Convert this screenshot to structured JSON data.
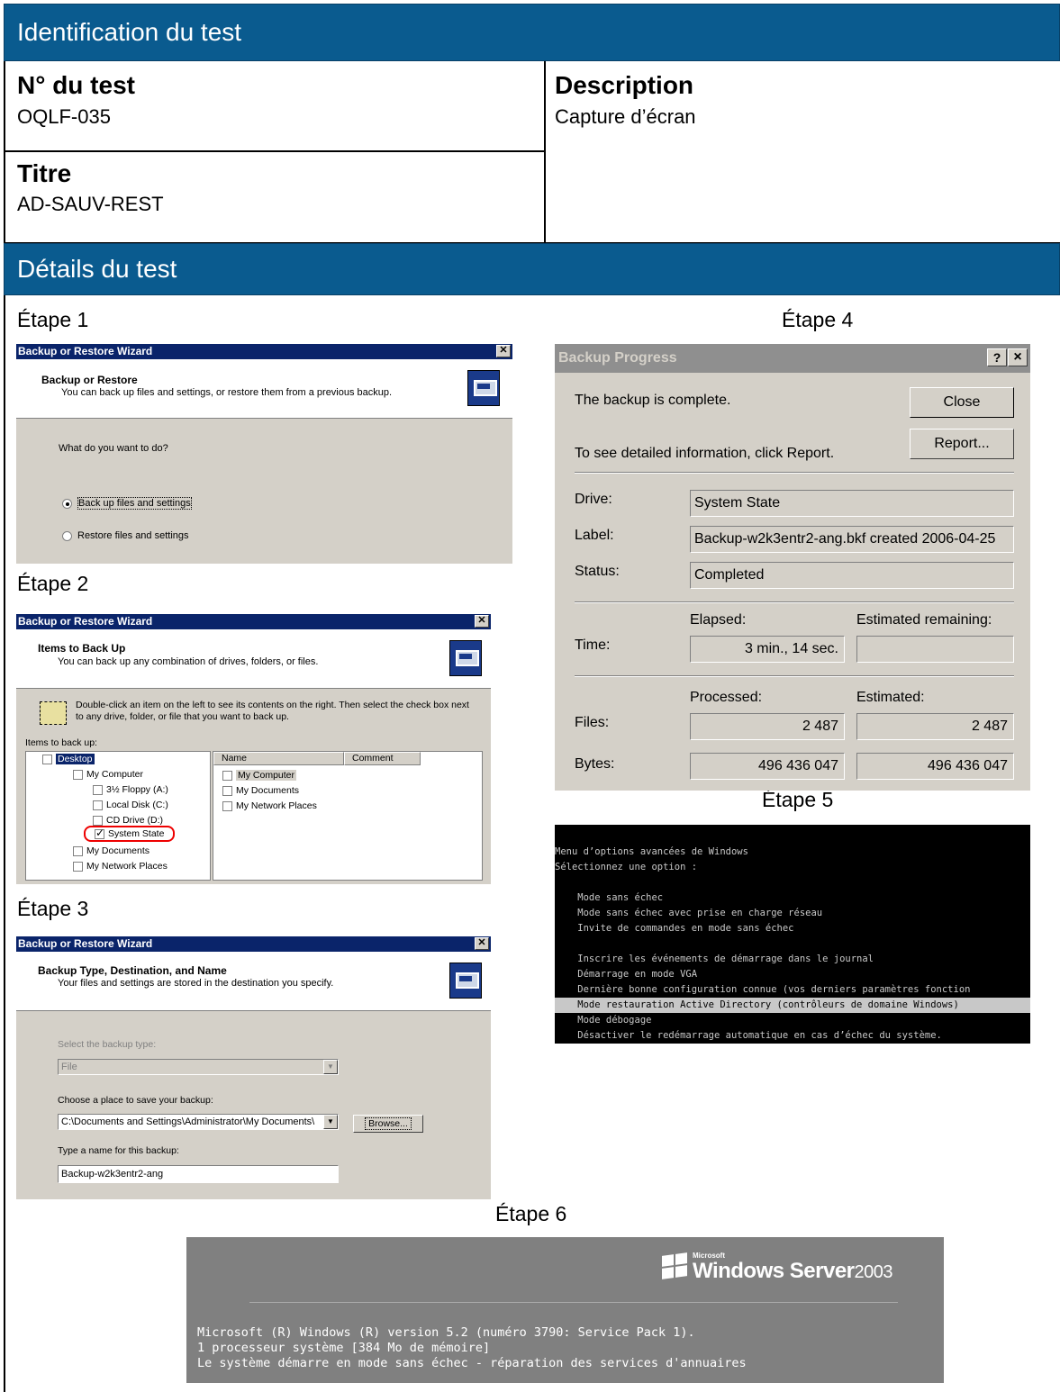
{
  "header": {
    "identification_title": "Identification du test",
    "details_title": "Détails du test"
  },
  "test": {
    "number_label": "N° du test",
    "number_value": "OQLF-035",
    "description_label": "Description",
    "description_value": "Capture d’écran",
    "title_label": "Titre",
    "title_value": "AD-SAUV-REST"
  },
  "steps": {
    "s1": "Étape 1",
    "s2": "Étape 2",
    "s3": "Étape 3",
    "s4": "Étape 4",
    "s5": "Étape 5",
    "s6": "Étape 6"
  },
  "wizard1": {
    "title": "Backup or Restore Wizard",
    "heading": "Backup or Restore",
    "subheading": "You can back up files and settings, or restore them from a previous backup.",
    "question": "What do you want to do?",
    "option1": "Back up files and settings",
    "option2": "Restore files and settings"
  },
  "wizard2": {
    "title": "Backup or Restore Wizard",
    "heading": "Items to Back Up",
    "subheading": "You can back up any combination of drives, folders, or files.",
    "instructions": "Double-click an item on the left to see its contents on the right. Then select the check box next to any drive, folder, or file that you want to back up.",
    "items_label": "Items to back up:",
    "tree": [
      "Desktop",
      "My Computer",
      "3½ Floppy (A:)",
      "Local Disk (C:)",
      "CD Drive (D:)",
      "System State",
      "My Documents",
      "My Network Places"
    ],
    "col_name": "Name",
    "col_comment": "Comment",
    "list": [
      "My Computer",
      "My Documents",
      "My Network Places"
    ]
  },
  "wizard3": {
    "title": "Backup or Restore Wizard",
    "heading": "Backup Type, Destination, and Name",
    "subheading": "Your files and settings are stored in the destination you specify.",
    "type_label": "Select the backup type:",
    "type_value": "File",
    "place_label": "Choose a place to save your backup:",
    "place_value": "C:\\Documents and Settings\\Administrator\\My Documents\\",
    "browse": "Browse...",
    "name_label": "Type a name for this backup:",
    "name_value": "Backup-w2k3entr2-ang"
  },
  "progress": {
    "title": "Backup Progress",
    "help_btn": "?",
    "close_x": "×",
    "complete_msg": "The backup is complete.",
    "report_msg": "To see detailed information, click Report.",
    "close_btn": "Close",
    "report_btn": "Report...",
    "drive_label": "Drive:",
    "drive_value": "System State",
    "label_label": "Label:",
    "label_value": "Backup-w2k3entr2-ang.bkf created 2006-04-25",
    "status_label": "Status:",
    "status_value": "Completed",
    "elapsed_label": "Elapsed:",
    "remaining_label": "Estimated remaining:",
    "time_label": "Time:",
    "time_value": "3 min., 14 sec.",
    "time_remaining": "",
    "processed_label": "Processed:",
    "estimated_label": "Estimated:",
    "files_label": "Files:",
    "files_processed": "2 487",
    "files_estimated": "2 487",
    "bytes_label": "Bytes:",
    "bytes_processed": "496 436 047",
    "bytes_estimated": "496 436 047"
  },
  "console": {
    "l1": "Menu d’options avancées de Windows",
    "l2": "Sélectionnez une option :",
    "l3": "    Mode sans échec",
    "l4": "    Mode sans échec avec prise en charge réseau",
    "l5": "    Invite de commandes en mode sans échec",
    "l6": "    Inscrire les événements de démarrage dans le journal",
    "l7": "    Démarrage en mode VGA",
    "l8": "    Dernière bonne configuration connue (vos derniers paramètres fonction",
    "l9": "    Mode restauration Active Directory (contrôleurs de domaine Windows)",
    "l10": "    Mode débogage",
    "l11": "    Désactiver le redémarrage automatique en cas d’échec du système."
  },
  "boot": {
    "brand_small": "Microsoft",
    "brand_main": "Windows Server",
    "brand_year": "2003",
    "line1": "Microsoft (R) Windows (R) version 5.2 (numéro 3790: Service Pack 1).",
    "line2": "1 processeur système [384 Mo de mémoire]",
    "line3": "Le système démarre en mode sans échec - réparation des services d'annuaires"
  }
}
